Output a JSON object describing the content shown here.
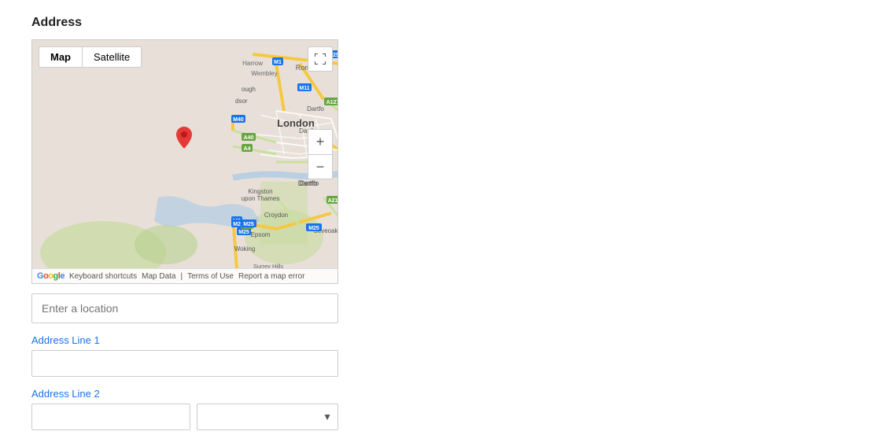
{
  "page": {
    "title": "Address"
  },
  "map": {
    "tab_map": "Map",
    "tab_satellite": "Satellite",
    "active_tab": "Map",
    "fullscreen_icon": "⛶",
    "zoom_in_label": "+",
    "zoom_out_label": "−",
    "footer": {
      "keyboard_shortcuts": "Keyboard shortcuts",
      "map_data": "Map Data",
      "terms": "Terms of Use",
      "report": "Report a map error"
    },
    "zoom_controls": {
      "plus": "+",
      "minus": "−"
    }
  },
  "form": {
    "location_placeholder": "Enter a location",
    "address_line1_label": "Address Line",
    "address_line1_num": "1",
    "address_line2_label": "Address Line",
    "address_line2_num": "2",
    "address_line1_value": "",
    "address_line2_value": "",
    "select_placeholder": ""
  }
}
